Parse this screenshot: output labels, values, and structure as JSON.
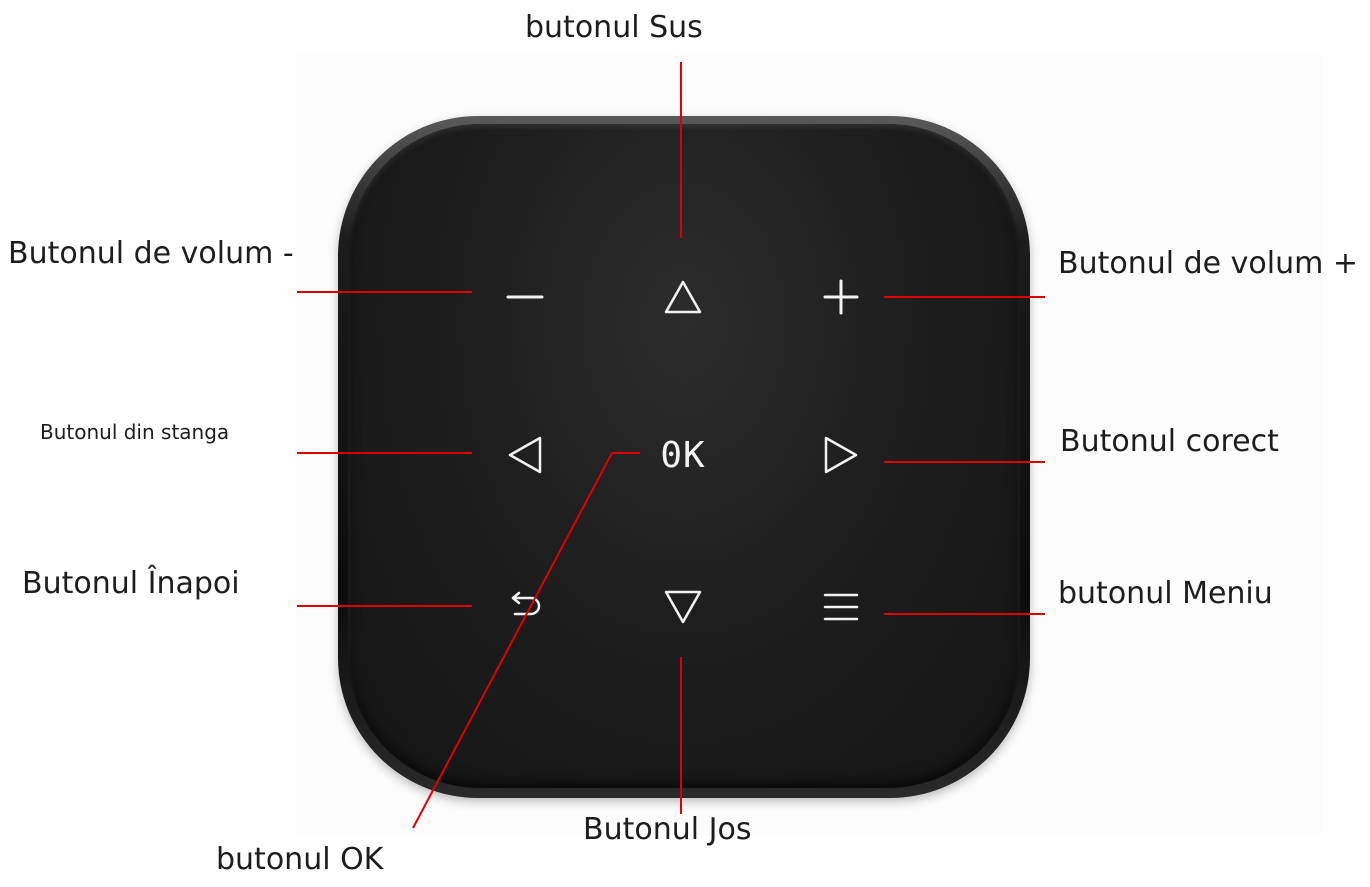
{
  "device": {
    "buttons": {
      "ok": {
        "glyph": "0K"
      }
    }
  },
  "labels": {
    "up": "butonul Sus",
    "volume_down": "Butonul de volum -",
    "volume_up": "Butonul de volum +",
    "left": "Butonul din stanga",
    "right": "Butonul corect",
    "back": "Butonul Înapoi",
    "menu": "butonul Meniu",
    "ok": "butonul OK",
    "down": "Butonul Jos"
  },
  "colors": {
    "leader_line": "#e00000",
    "pad_body": "#1a1a1a",
    "glyph": "#f2f2f2",
    "label_text": "#1d1d1d"
  },
  "icons": [
    "minus-icon",
    "triangle-up-icon",
    "plus-icon",
    "triangle-left-icon",
    "triangle-right-icon",
    "back-arrow-icon",
    "triangle-down-icon",
    "menu-icon"
  ]
}
